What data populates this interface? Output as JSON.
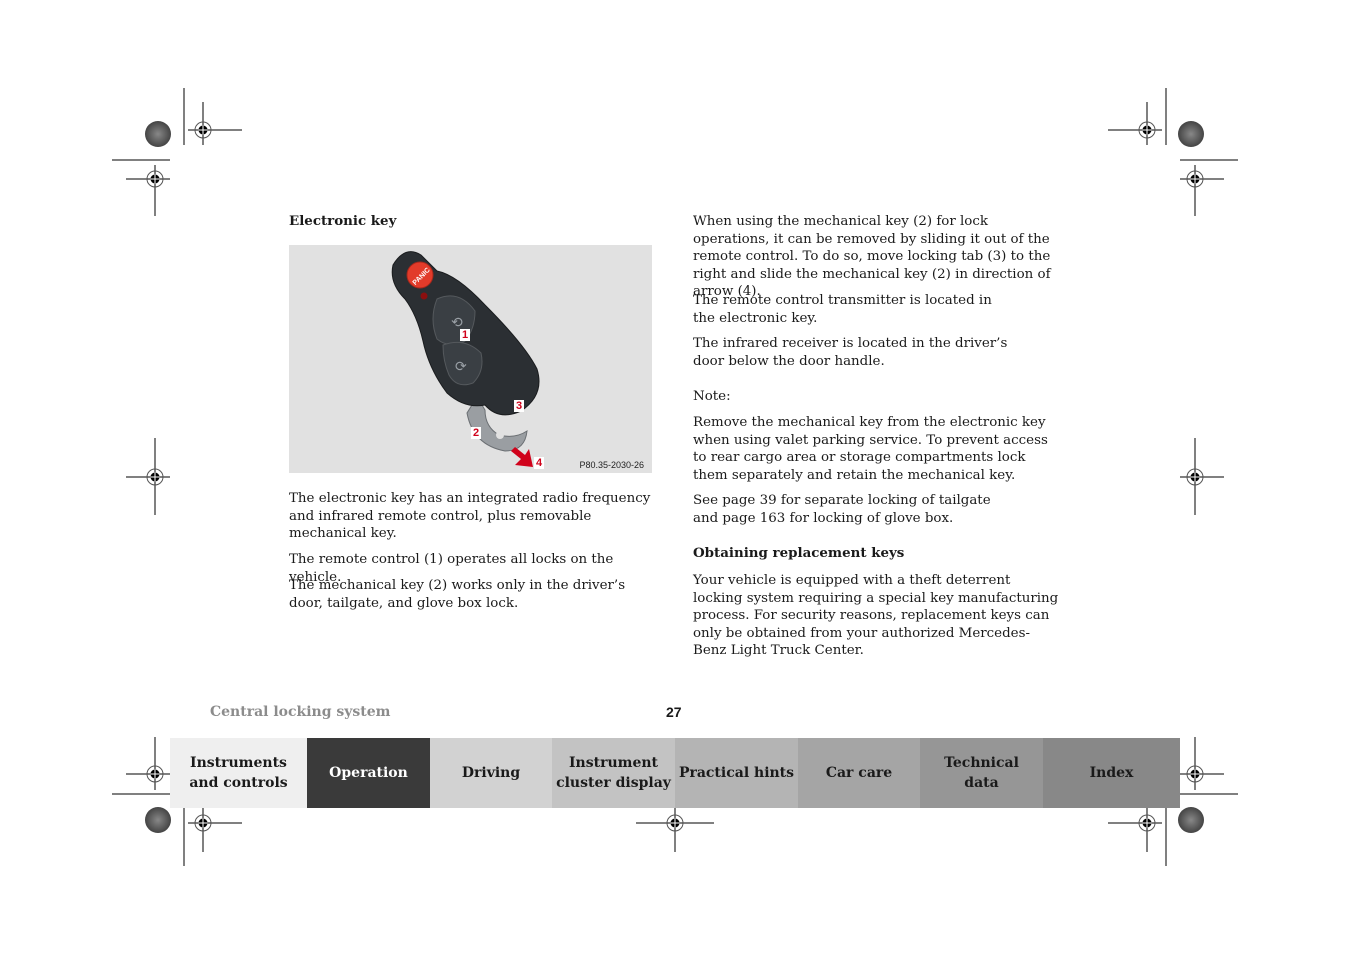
{
  "section": {
    "title": "Electronic key",
    "figure": {
      "code": "P80.35-2030-26",
      "panic_label": "PANIC",
      "callouts": [
        "1",
        "2",
        "3",
        "4"
      ]
    },
    "left_paragraphs": [
      "The electronic key has an integrated radio frequency and infrared remote control, plus removable mechanical key.",
      "The remote control (1) operates all locks on the vehicle.",
      "The mechanical key (2) works only in the driver’s door, tailgate, and glove box lock."
    ],
    "right_paragraphs": [
      "When using the mechanical key (2) for lock operations, it can be removed by sliding it out of the remote control. To do so, move locking tab (3) to the right and slide the mechanical key (2) in direction of arrow (4).",
      "The remote control transmitter is located in the electronic key.",
      "The infrared receiver is located in the driver’s door below the door handle."
    ],
    "note_label": "Note:",
    "note_paragraphs": [
      "Remove the mechanical key from the electronic key when using valet parking service. To prevent access to rear cargo area or storage compartments lock them separately and retain the mechanical key.",
      "See page 39 for separate locking of tailgate and page 163 for locking of glove box."
    ],
    "subheading": "Obtaining replacement keys",
    "replacement_paragraph": "Your vehicle is equipped with a theft deterrent locking system requiring a special key manufacturing process. For security reasons, replacement keys can only be obtained from your authorized Mercedes-Benz Light Truck Center."
  },
  "footer": {
    "section_name": "Central locking system",
    "page_number": "27"
  },
  "nav_tabs": [
    {
      "label_line1": "Instruments",
      "label_line2": "and controls",
      "bg": "#efefef",
      "fg": "#1a1a1a"
    },
    {
      "label_line1": "Operation",
      "label_line2": "",
      "bg": "#3a3a3a",
      "fg": "#ffffff",
      "active": true
    },
    {
      "label_line1": "Driving",
      "label_line2": "",
      "bg": "#d2d2d2",
      "fg": "#1a1a1a"
    },
    {
      "label_line1": "Instrument",
      "label_line2": "cluster display",
      "bg": "#c3c3c3",
      "fg": "#1a1a1a"
    },
    {
      "label_line1": "Practical hints",
      "label_line2": "",
      "bg": "#b4b4b4",
      "fg": "#1a1a1a"
    },
    {
      "label_line1": "Car care",
      "label_line2": "",
      "bg": "#a5a5a5",
      "fg": "#1a1a1a"
    },
    {
      "label_line1": "Technical",
      "label_line2": "data",
      "bg": "#969696",
      "fg": "#1a1a1a"
    },
    {
      "label_line1": "Index",
      "label_line2": "",
      "bg": "#888888",
      "fg": "#1a1a1a"
    }
  ],
  "colors": {
    "figure_bg": "#e1e1e1",
    "callout_red": "#d0021b",
    "key_body": "#2b2f33",
    "panic_red": "#e23b2a"
  }
}
